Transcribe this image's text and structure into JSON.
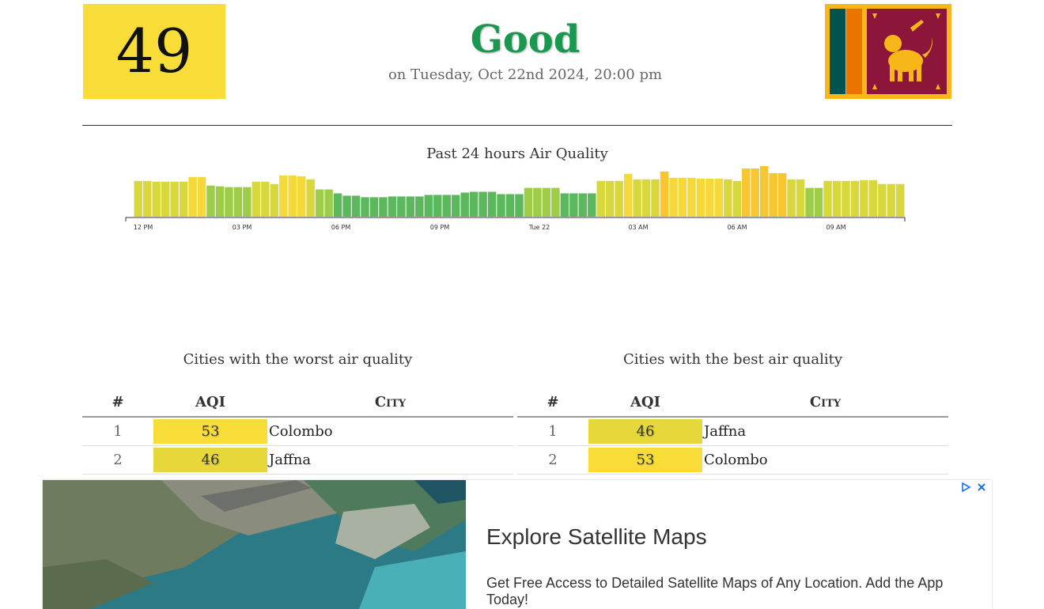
{
  "current": {
    "aqi": "49",
    "status": "Good",
    "timestamp": "on Tuesday, Oct 22nd 2024, 20:00 pm",
    "status_color": "#1a9850",
    "box_color": "#f8dd38"
  },
  "flag": {
    "icon": "sri-lanka-flag-icon"
  },
  "chart_data": {
    "type": "bar",
    "title": "Past 24 hours Air Quality",
    "tick_labels": [
      "12 PM",
      "03 PM",
      "06 PM",
      "09 PM",
      "Tue 22",
      "03 AM",
      "06 AM",
      "09 AM"
    ],
    "values": [
      46,
      46,
      45,
      45,
      45,
      45,
      51,
      51,
      40,
      39,
      38,
      38,
      38,
      45,
      45,
      42,
      53,
      53,
      52,
      48,
      35,
      35,
      30,
      27,
      27,
      25,
      25,
      25,
      26,
      26,
      26,
      26,
      28,
      28,
      28,
      28,
      31,
      32,
      32,
      32,
      29,
      29,
      29,
      37,
      37,
      37,
      37,
      30,
      30,
      30,
      30,
      46,
      46,
      46,
      55,
      48,
      48,
      48,
      58,
      50,
      50,
      50,
      49,
      49,
      49,
      48,
      46,
      62,
      62,
      65,
      56,
      56,
      48,
      48,
      37,
      37,
      46,
      46,
      46,
      46,
      47,
      47,
      42,
      42,
      42
    ]
  },
  "worst": {
    "title": "Cities with the worst air quality",
    "headers": {
      "rank": "#",
      "aqi": "AQI",
      "city": "City"
    },
    "rows": [
      {
        "rank": "1",
        "aqi": "53",
        "city": "Colombo",
        "color": "#f8dd38"
      },
      {
        "rank": "2",
        "aqi": "46",
        "city": "Jaffna",
        "color": "#e6d83b"
      }
    ]
  },
  "best": {
    "title": "Cities with the best air quality",
    "headers": {
      "rank": "#",
      "aqi": "AQI",
      "city": "City"
    },
    "rows": [
      {
        "rank": "1",
        "aqi": "46",
        "city": "Jaffna",
        "color": "#e6d83b"
      },
      {
        "rank": "2",
        "aqi": "53",
        "city": "Colombo",
        "color": "#f8dd38"
      }
    ]
  },
  "ad": {
    "title": "Explore Satellite Maps",
    "text": "Get Free Access to Detailed Satellite Maps of Any Location. Add the App Today!",
    "play_icon": "adchoices-play-icon",
    "close_icon": "close-icon"
  }
}
